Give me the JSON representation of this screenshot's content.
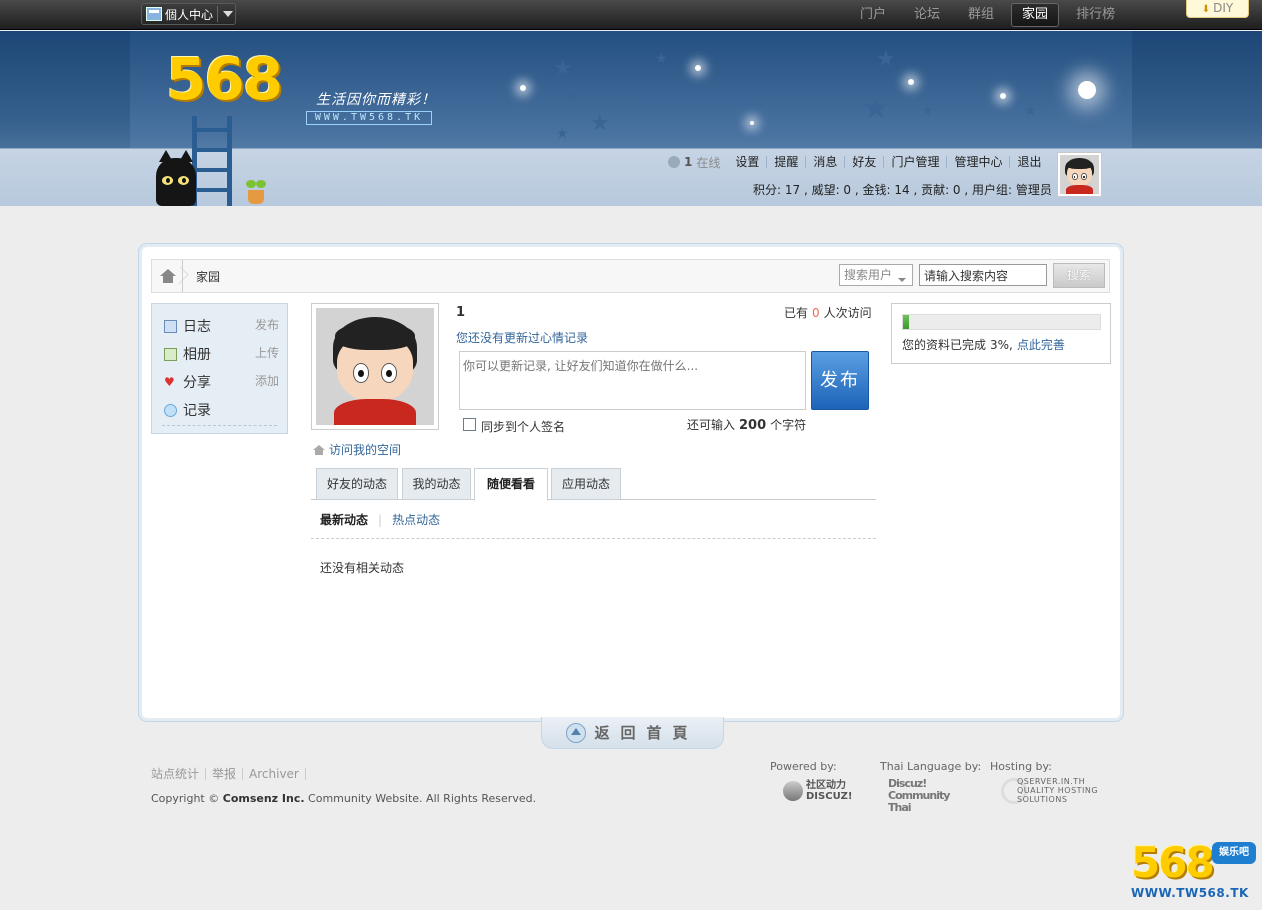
{
  "topbar": {
    "personal_center": "個人中心",
    "nav": [
      "门户",
      "论坛",
      "群组",
      "家园",
      "排行榜"
    ],
    "active_nav": "家园",
    "diy": "DIY"
  },
  "header": {
    "logo_text": "568",
    "slogan": "生活因你而精彩！",
    "logo_url": "WWW.TW568.TK"
  },
  "userbar": {
    "online_count": "1",
    "online_label": "在线",
    "links": [
      "设置",
      "提醒",
      "消息",
      "好友",
      "门户管理",
      "管理中心",
      "退出"
    ],
    "credits": "积分: 17 , 威望: 0 , 金钱: 14 , 贡献: 0 , 用户组: 管理员"
  },
  "breadcrumb": {
    "current": "家园"
  },
  "search": {
    "type_label": "搜索用户",
    "input_value": "请输入搜索内容",
    "button": "搜索"
  },
  "sidebar": {
    "items": [
      {
        "label": "日志",
        "action": "发布"
      },
      {
        "label": "相册",
        "action": "上传"
      },
      {
        "label": "分享",
        "action": "添加"
      },
      {
        "label": "记录",
        "action": ""
      }
    ]
  },
  "profile": {
    "username": "1",
    "visits_prefix": "已有",
    "visits_count": "0",
    "visits_suffix": "人次访问",
    "status_link": "您还没有更新过心情记录",
    "status_placeholder": "你可以更新记录, 让好友们知道你在做什么...",
    "publish": "发布",
    "sync_label": "同步到个人签名",
    "chars_prefix": "还可输入",
    "chars_count": "200",
    "chars_suffix": "个字符",
    "visit_space": "访问我的空间"
  },
  "tabs": {
    "items": [
      "好友的动态",
      "我的动态",
      "随便看看",
      "应用动态"
    ],
    "active": "随便看看"
  },
  "subtabs": {
    "latest": "最新动态",
    "hot": "热点动态"
  },
  "feed": {
    "empty": "还没有相关动态"
  },
  "completion": {
    "prefix": "您的资料已完成",
    "percent_text": "3%,",
    "percent_value": 3,
    "link": "点此完善"
  },
  "return_home": "返回首頁",
  "footer": {
    "links": [
      "站点统计",
      "举报",
      "Archiver"
    ],
    "copyright_prefix": "Copyright ©",
    "copyright_company": "Comsenz Inc.",
    "copyright_suffix": "Community Website. All Rights Reserved.",
    "powered_by": "Powered by:",
    "thai_by": "Thai Language by:",
    "hosting_by": "Hosting by:",
    "powered_logo": "社区动力 DISCUZ!",
    "thai_logo": "Discuz! Community Thai",
    "hosting_logo": "QSERVER.IN.TH QUALITY HOSTING SOLUTIONS"
  },
  "watermark": {
    "number": "568",
    "badge": "娱乐吧",
    "url": "WWW.TW568.TK"
  },
  "colors": {
    "link": "#336699",
    "accent_blue": "#1d63b8",
    "header_dark": "#1d4676",
    "progress_green": "#3b9a2c"
  }
}
